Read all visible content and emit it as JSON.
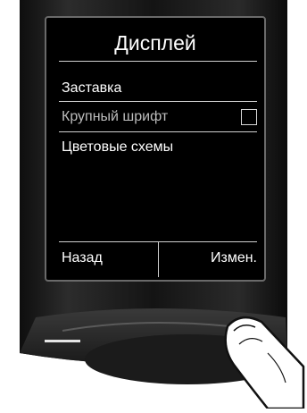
{
  "screen": {
    "title": "Дисплей",
    "menu": [
      {
        "label": "Заставка",
        "dim": false
      },
      {
        "label": "Крупный шрифт",
        "dim": true,
        "checkbox": "unchecked"
      },
      {
        "label": "Цветовые схемы",
        "dim": false
      }
    ],
    "softkeys": {
      "left": "Назад",
      "right": "Измен."
    }
  },
  "colors": {
    "background": "#000000",
    "text": "#ffffff",
    "dim_text": "#bdbdbd",
    "bezel": "#6a6a6a"
  }
}
